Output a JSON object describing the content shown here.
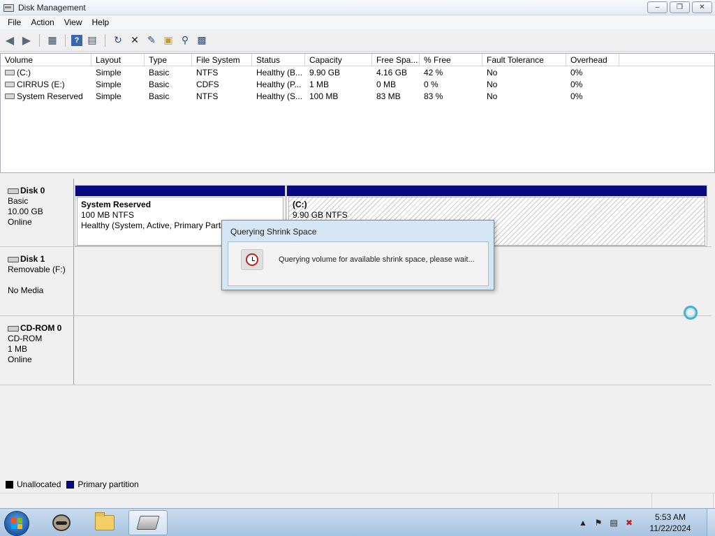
{
  "window": {
    "title": "Disk Management",
    "minimize_icon": "minimize-icon",
    "maximize_icon": "restore-icon",
    "close_icon": "close-icon"
  },
  "menu": [
    "File",
    "Action",
    "View",
    "Help"
  ],
  "toolbar": {
    "icons": [
      "back-arrow-icon",
      "forward-arrow-icon",
      "console-tree-icon",
      "help-icon",
      "properties-icon",
      "refresh-icon",
      "delete-icon",
      "properties-sheet-icon",
      "open-icon",
      "explore-icon",
      "rescan-icon"
    ]
  },
  "volume_list": {
    "columns": [
      "Volume",
      "Layout",
      "Type",
      "File System",
      "Status",
      "Capacity",
      "Free Spa...",
      "% Free",
      "Fault Tolerance",
      "Overhead"
    ],
    "rows": [
      [
        "(C:)",
        "Simple",
        "Basic",
        "NTFS",
        "Healthy (B...",
        "9.90 GB",
        "4.16 GB",
        "42 %",
        "No",
        "0%"
      ],
      [
        "CIRRUS (E:)",
        "Simple",
        "Basic",
        "CDFS",
        "Healthy (P...",
        "1 MB",
        "0 MB",
        "0 %",
        "No",
        "0%"
      ],
      [
        "System Reserved",
        "Simple",
        "Basic",
        "NTFS",
        "Healthy (S...",
        "100 MB",
        "83 MB",
        "83 %",
        "No",
        "0%"
      ]
    ]
  },
  "disks": [
    {
      "name": "Disk 0",
      "line1": "Basic",
      "line2": "10.00 GB",
      "line3": "Online",
      "partitions": [
        {
          "name": "System Reserved",
          "size": "100 MB NTFS",
          "status": "Healthy (System, Active, Primary Partition)"
        },
        {
          "name": "(C:)",
          "size": "9.90 GB NTFS",
          "status": ")"
        }
      ]
    },
    {
      "name": "Disk 1",
      "line1": "Removable (F:)",
      "line2": "",
      "line3": "No Media"
    },
    {
      "name": "CD-ROM 0",
      "line1": "CD-ROM",
      "line2": "1 MB",
      "line3": "Online"
    }
  ],
  "legend": [
    {
      "label": "Unallocated",
      "color": "#000000"
    },
    {
      "label": "Primary partition",
      "color": "#0a0a80"
    }
  ],
  "dialog": {
    "title": "Querying Shrink Space",
    "message": "Querying volume for available shrink space, please wait...",
    "icon": "clock-icon"
  },
  "taskbar": {
    "apps": [
      "raccoon-app-icon",
      "explorer-folder-icon",
      "disk-management-icon"
    ],
    "time": "5:53 AM",
    "date": "11/22/2024",
    "tray_icons": [
      "show-hidden-icons",
      "action-center-flag-icon",
      "network-icon",
      "volume-muted-icon"
    ]
  }
}
